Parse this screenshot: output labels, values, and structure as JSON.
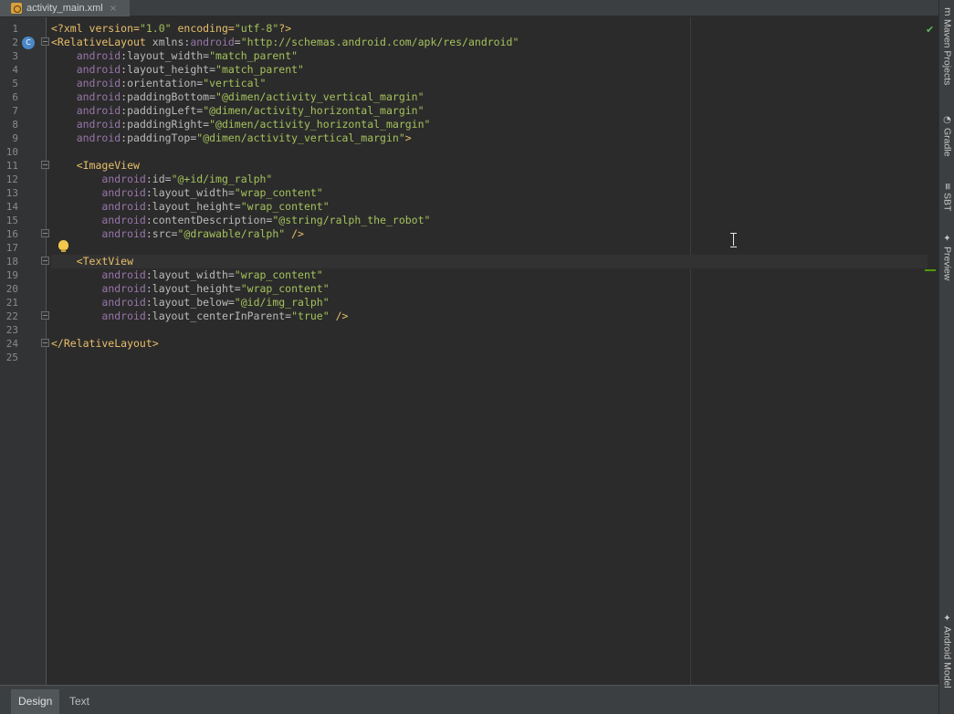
{
  "tab": {
    "file_name": "activity_main.xml",
    "close_glyph": "×",
    "icon": "xml-file-icon"
  },
  "gutter": {
    "line_numbers": [
      "1",
      "2",
      "3",
      "4",
      "5",
      "6",
      "7",
      "8",
      "9",
      "10",
      "11",
      "12",
      "13",
      "14",
      "15",
      "16",
      "17",
      "18",
      "19",
      "20",
      "21",
      "22",
      "23",
      "24",
      "25"
    ],
    "class_marker": "C"
  },
  "code_lines": [
    [
      {
        "t": "<?xml version=",
        "c": "tag"
      },
      {
        "t": "\"1.0\"",
        "c": "val"
      },
      {
        "t": " encoding=",
        "c": "tag"
      },
      {
        "t": "\"utf-8\"",
        "c": "val"
      },
      {
        "t": "?>",
        "c": "tag"
      }
    ],
    [
      {
        "t": "<RelativeLayout ",
        "c": "tag"
      },
      {
        "t": "xmlns:",
        "c": "attr"
      },
      {
        "t": "android",
        "c": "ns"
      },
      {
        "t": "=",
        "c": "attr"
      },
      {
        "t": "\"http://schemas.android.com/apk/res/android\"",
        "c": "val"
      }
    ],
    [
      {
        "t": "    ",
        "c": "attr"
      },
      {
        "t": "android",
        "c": "ns"
      },
      {
        "t": ":layout_width=",
        "c": "attr"
      },
      {
        "t": "\"match_parent\"",
        "c": "val"
      }
    ],
    [
      {
        "t": "    ",
        "c": "attr"
      },
      {
        "t": "android",
        "c": "ns"
      },
      {
        "t": ":layout_height=",
        "c": "attr"
      },
      {
        "t": "\"match_parent\"",
        "c": "val"
      }
    ],
    [
      {
        "t": "    ",
        "c": "attr"
      },
      {
        "t": "android",
        "c": "ns"
      },
      {
        "t": ":orientation=",
        "c": "attr"
      },
      {
        "t": "\"vertical\"",
        "c": "val"
      }
    ],
    [
      {
        "t": "    ",
        "c": "attr"
      },
      {
        "t": "android",
        "c": "ns"
      },
      {
        "t": ":paddingBottom=",
        "c": "attr"
      },
      {
        "t": "\"@dimen/activity_vertical_margin\"",
        "c": "val"
      }
    ],
    [
      {
        "t": "    ",
        "c": "attr"
      },
      {
        "t": "android",
        "c": "ns"
      },
      {
        "t": ":paddingLeft=",
        "c": "attr"
      },
      {
        "t": "\"@dimen/activity_horizontal_margin\"",
        "c": "val"
      }
    ],
    [
      {
        "t": "    ",
        "c": "attr"
      },
      {
        "t": "android",
        "c": "ns"
      },
      {
        "t": ":paddingRight=",
        "c": "attr"
      },
      {
        "t": "\"@dimen/activity_horizontal_margin\"",
        "c": "val"
      }
    ],
    [
      {
        "t": "    ",
        "c": "attr"
      },
      {
        "t": "android",
        "c": "ns"
      },
      {
        "t": ":paddingTop=",
        "c": "attr"
      },
      {
        "t": "\"@dimen/activity_vertical_margin\"",
        "c": "val"
      },
      {
        "t": ">",
        "c": "tag"
      }
    ],
    [],
    [
      {
        "t": "    ",
        "c": "attr"
      },
      {
        "t": "<ImageView",
        "c": "tag"
      }
    ],
    [
      {
        "t": "        ",
        "c": "attr"
      },
      {
        "t": "android",
        "c": "ns"
      },
      {
        "t": ":id=",
        "c": "attr"
      },
      {
        "t": "\"@+id/img_ralph\"",
        "c": "val"
      }
    ],
    [
      {
        "t": "        ",
        "c": "attr"
      },
      {
        "t": "android",
        "c": "ns"
      },
      {
        "t": ":layout_width=",
        "c": "attr"
      },
      {
        "t": "\"wrap_content\"",
        "c": "val"
      }
    ],
    [
      {
        "t": "        ",
        "c": "attr"
      },
      {
        "t": "android",
        "c": "ns"
      },
      {
        "t": ":layout_height=",
        "c": "attr"
      },
      {
        "t": "\"wrap_content\"",
        "c": "val"
      }
    ],
    [
      {
        "t": "        ",
        "c": "attr"
      },
      {
        "t": "android",
        "c": "ns"
      },
      {
        "t": ":contentDescription=",
        "c": "attr"
      },
      {
        "t": "\"@string/ralph_the_robot\"",
        "c": "val"
      }
    ],
    [
      {
        "t": "        ",
        "c": "attr"
      },
      {
        "t": "android",
        "c": "ns"
      },
      {
        "t": ":src=",
        "c": "attr"
      },
      {
        "t": "\"@drawable/ralph\"",
        "c": "val"
      },
      {
        "t": " />",
        "c": "tag"
      }
    ],
    [],
    [
      {
        "t": "    ",
        "c": "attr"
      },
      {
        "t": "<TextView",
        "c": "tag"
      }
    ],
    [
      {
        "t": "        ",
        "c": "attr"
      },
      {
        "t": "android",
        "c": "ns"
      },
      {
        "t": ":layout_width=",
        "c": "attr"
      },
      {
        "t": "\"wrap_content\"",
        "c": "val"
      }
    ],
    [
      {
        "t": "        ",
        "c": "attr"
      },
      {
        "t": "android",
        "c": "ns"
      },
      {
        "t": ":layout_height=",
        "c": "attr"
      },
      {
        "t": "\"wrap_content\"",
        "c": "val"
      }
    ],
    [
      {
        "t": "        ",
        "c": "attr"
      },
      {
        "t": "android",
        "c": "ns"
      },
      {
        "t": ":layout_below=",
        "c": "attr"
      },
      {
        "t": "\"@id/img_ralph\"",
        "c": "val"
      }
    ],
    [
      {
        "t": "        ",
        "c": "attr"
      },
      {
        "t": "android",
        "c": "ns"
      },
      {
        "t": ":layout_centerInParent=",
        "c": "attr"
      },
      {
        "t": "\"true\"",
        "c": "val"
      },
      {
        "t": " />",
        "c": "tag"
      }
    ],
    [],
    [
      {
        "t": "</RelativeLayout>",
        "c": "tag"
      }
    ],
    []
  ],
  "caret_line": 18,
  "right_tools": [
    {
      "label": "Maven Projects",
      "icon": "maven-icon",
      "glyph": "m"
    },
    {
      "label": "Gradle",
      "icon": "gradle-icon",
      "glyph": "◔"
    },
    {
      "label": "SBT",
      "icon": "sbt-icon",
      "glyph": "≡"
    },
    {
      "label": "Preview",
      "icon": "android-icon",
      "glyph": "✦"
    },
    {
      "label": "Android Model",
      "icon": "android-icon",
      "glyph": "✦"
    }
  ],
  "bottom_tabs": [
    {
      "label": "Design",
      "active": true
    },
    {
      "label": "Text",
      "active": false
    }
  ],
  "colors": {
    "background": "#2b2b2b",
    "tag": "#e8bf6a",
    "namespace": "#9876aa",
    "attribute": "#bababa",
    "value": "#a5c25c"
  }
}
